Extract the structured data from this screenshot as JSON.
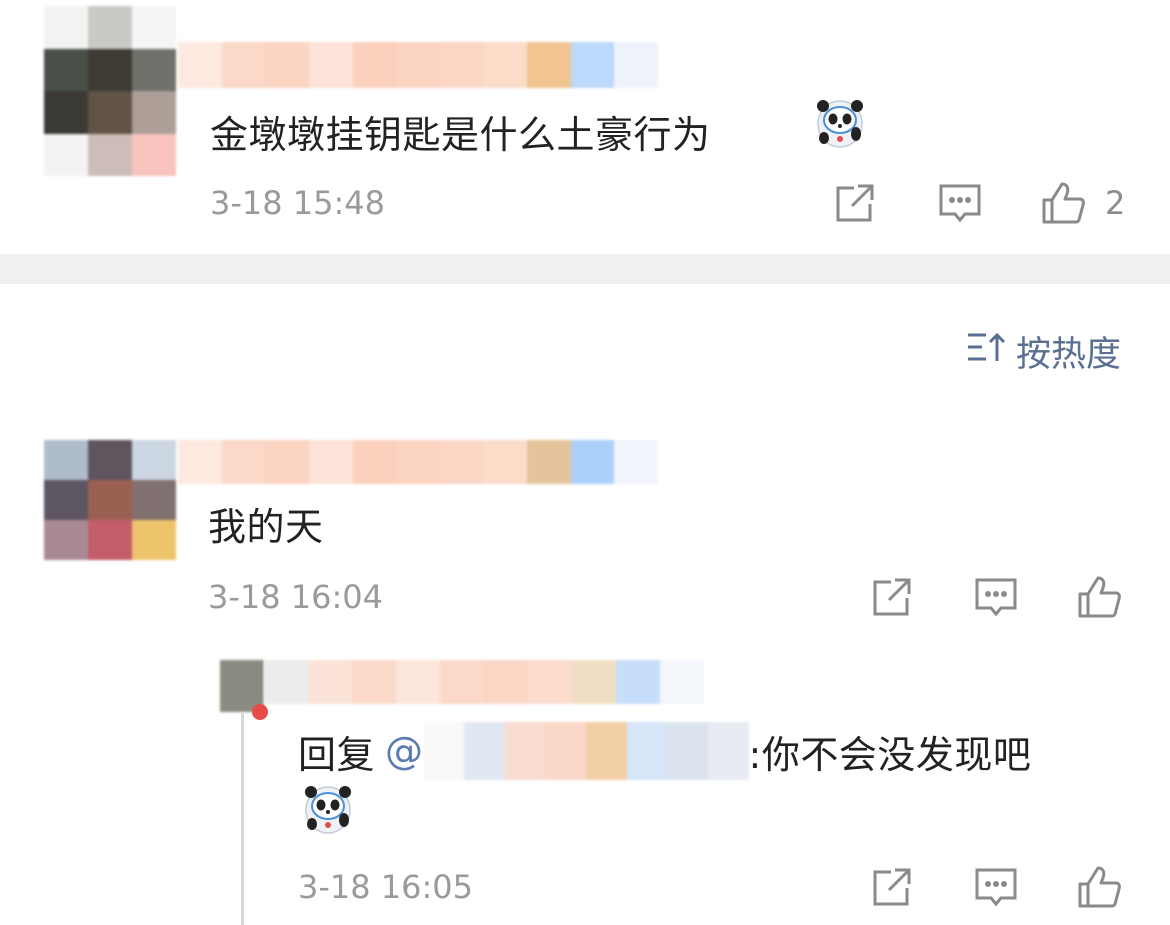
{
  "comments": [
    {
      "text": "金墩墩挂钥匙是什么土豪行为",
      "emoji": "bingdwendwen-icon",
      "time": "3-18 15:48",
      "likes": "2"
    },
    {
      "text": "我的天",
      "time": "3-18 16:04",
      "likes": ""
    }
  ],
  "sort": {
    "label": "按热度",
    "icon": "sort-icon"
  },
  "reply": {
    "prefix": "回复",
    "at": "@",
    "suffix": ":你不会没发现吧",
    "emoji": "bingdwendwen-icon",
    "time": "3-18 16:05"
  },
  "colors": {
    "accent": "#5a6f92",
    "mention": "#5a7cb0",
    "muted": "#9a9a9a",
    "divider": "#f0f0f0"
  }
}
